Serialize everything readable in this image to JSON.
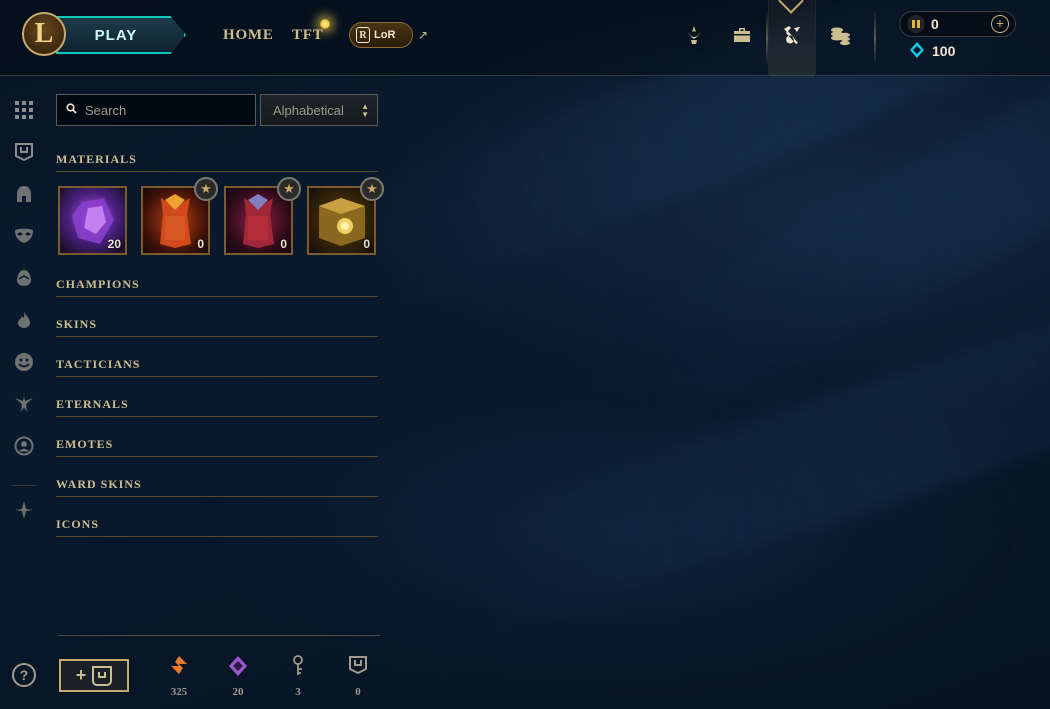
{
  "nav": {
    "logo": "L",
    "play_label": "PLAY",
    "home_label": "HOME",
    "tft_label": "TFT",
    "lor_label": "LoR",
    "lor_icon": "R",
    "external_icon": "↗"
  },
  "currency": {
    "rp_value": "0",
    "be_value": "100",
    "add_icon": "+"
  },
  "search": {
    "placeholder": "Search",
    "sort_value": "Alphabetical"
  },
  "categories": {
    "materials": "MATERIALS",
    "champions": "CHAMPIONS",
    "skins": "SKINS",
    "tacticians": "TACTICIANS",
    "eternals": "ETERNALS",
    "emotes": "EMOTES",
    "ward_skins": "WARD SKINS",
    "icons": "ICONS"
  },
  "materials": [
    {
      "name": "gemstone",
      "count": "20"
    },
    {
      "name": "orange-capsule",
      "count": "0"
    },
    {
      "name": "red-capsule",
      "count": "0"
    },
    {
      "name": "golden-chest",
      "count": "0"
    }
  ],
  "footer": {
    "help": "?",
    "craft_plus": "+",
    "resources": [
      {
        "name": "orange-essence",
        "value": "325"
      },
      {
        "name": "mythic-essence",
        "value": "20"
      },
      {
        "name": "key",
        "value": "3"
      },
      {
        "name": "chest",
        "value": "0"
      }
    ]
  },
  "colors": {
    "gold": "#c8aa6e",
    "teal": "#0ac8b9",
    "blue_essence": "#0acbe6",
    "background": "#0a1a2d"
  }
}
